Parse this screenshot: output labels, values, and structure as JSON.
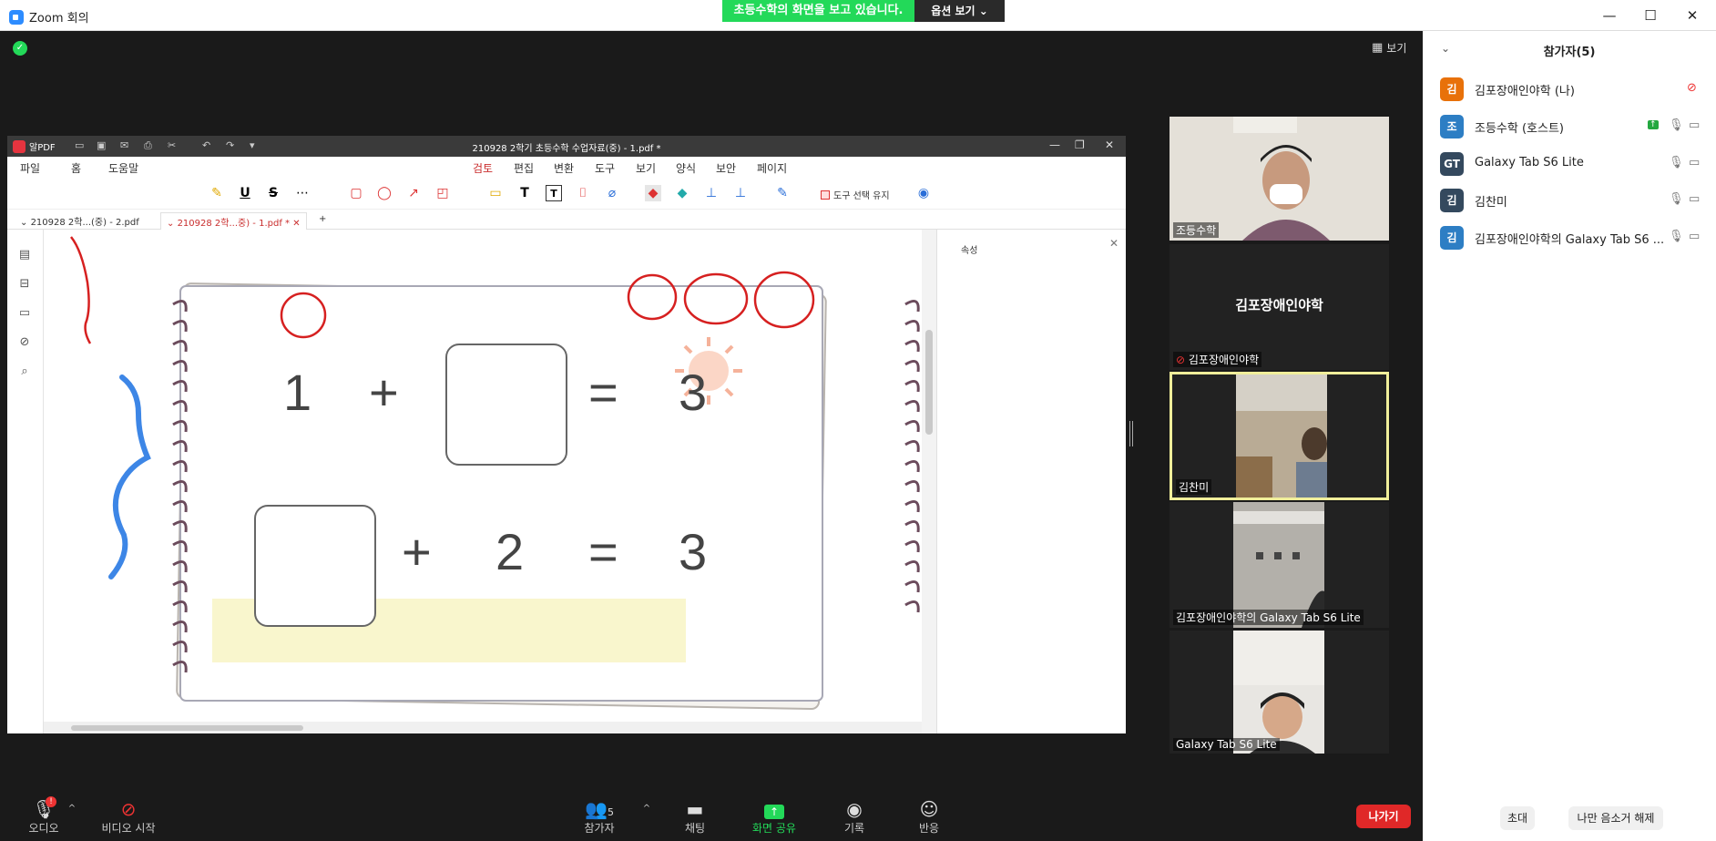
{
  "window": {
    "title": "Zoom 회의"
  },
  "banner": {
    "text": "초등수학의 화면을 보고 있습니다.",
    "view_options": "옵션 보기"
  },
  "view_button": "보기",
  "pdf": {
    "app_name": "알PDF",
    "title": "210928  2학기 초등수학 수업자료(중) - 1.pdf *",
    "menu": [
      "파일",
      "홈",
      "도움말",
      "검토",
      "편집",
      "변환",
      "도구",
      "보기",
      "양식",
      "보안",
      "페이지"
    ],
    "keep_tool": "도구 선택 유지",
    "tabs": [
      "210928 2학...(중) - 2.pdf",
      "210928 2학...중) - 1.pdf *"
    ],
    "props_title": "속성",
    "equation1": [
      "1",
      "+",
      "",
      "=",
      "3"
    ],
    "equation2": [
      "",
      "+",
      "2",
      "=",
      "3"
    ]
  },
  "gallery": [
    {
      "name": "조등수학"
    },
    {
      "name": "김포장애인야학",
      "center_label": "김포장애인야학"
    },
    {
      "name": "김찬미"
    },
    {
      "name": "김포장애인야학의  Galaxy Tab S6 Lite"
    },
    {
      "name": "Galaxy Tab S6 Lite"
    }
  ],
  "participants": {
    "header": "참가자(5)",
    "list": [
      {
        "initial": "김",
        "name": "김포장애인야학 (나)",
        "color": "#e8710a"
      },
      {
        "initial": "조",
        "name": "조등수학 (호스트)",
        "color": "#2d7ec4"
      },
      {
        "initial": "GT",
        "name": "Galaxy Tab S6 Lite",
        "color": "#34495e"
      },
      {
        "initial": "김",
        "name": "김찬미",
        "color": "#34495e"
      },
      {
        "initial": "김",
        "name": "김포장애인야학의 Galaxy Tab S6 ...",
        "color": "#2d7ec4"
      }
    ],
    "invite": "초대",
    "unmute_me": "나만 음소거 해제"
  },
  "bottom": {
    "audio": "오디오",
    "audio_badge": "!",
    "video": "비디오 시작",
    "participants": "참가자",
    "participants_count": "5",
    "chat": "채팅",
    "share": "화면 공유",
    "record": "기록",
    "reactions": "반응",
    "leave": "나가기"
  }
}
